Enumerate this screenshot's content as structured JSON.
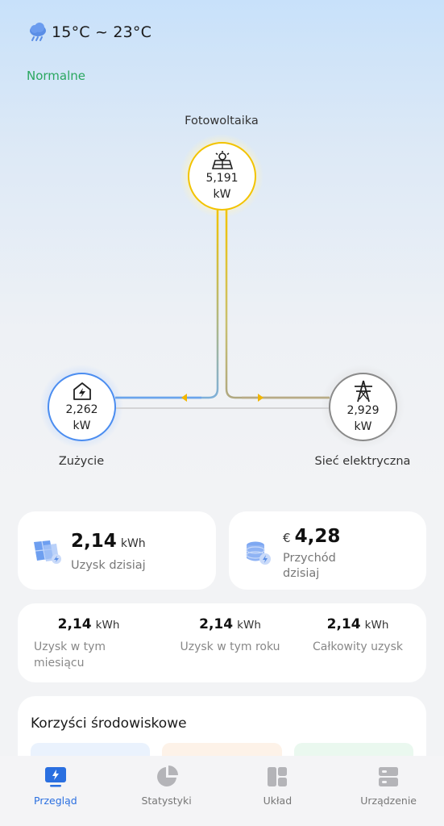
{
  "header": {
    "weather_icon": "cloud-rain-icon",
    "temperature": "15°C ~ 23°C",
    "status": "Normalne"
  },
  "flow": {
    "pv": {
      "label": "Fotowoltaika",
      "value": "5,191",
      "unit": "kW",
      "icon": "solar-panel-icon",
      "color": "#f2c300"
    },
    "consumption": {
      "label": "Zużycie",
      "value": "2,262",
      "unit": "kW",
      "icon": "home-bolt-icon",
      "color": "#4b8df0"
    },
    "grid": {
      "label": "Sieć elektryczna",
      "value": "2,929",
      "unit": "kW",
      "icon": "power-tower-icon",
      "color": "#8a8a8a"
    }
  },
  "cards": {
    "yield_today": {
      "value": "2,14",
      "unit": "kWh",
      "label": "Uzysk dzisiaj",
      "icon": "solar-panels-icon"
    },
    "income_today": {
      "currency": "€",
      "value": "4,28",
      "label_line1": "Przychód",
      "label_line2": "dzisiaj",
      "icon": "coins-icon"
    }
  },
  "stats": [
    {
      "value": "2,14",
      "unit": "kWh",
      "label_line1": "Uzysk w tym",
      "label_line2": "miesiącu"
    },
    {
      "value": "2,14",
      "unit": "kWh",
      "label_line1": "Uzysk w tym roku",
      "label_line2": ""
    },
    {
      "value": "2,14",
      "unit": "kWh",
      "label_line1": "Całkowity uzysk",
      "label_line2": ""
    }
  ],
  "env": {
    "title": "Korzyści środowiskowe"
  },
  "nav": [
    {
      "label": "Przegląd",
      "icon": "monitor-bolt-icon",
      "active": true
    },
    {
      "label": "Statystyki",
      "icon": "pie-chart-icon",
      "active": false
    },
    {
      "label": "Układ",
      "icon": "layout-icon",
      "active": false
    },
    {
      "label": "Urządzenie",
      "icon": "device-icon",
      "active": false
    }
  ],
  "colors": {
    "accent": "#2a6fe0",
    "status_green": "#2aa760",
    "pv": "#f2c300",
    "load": "#4b8df0",
    "grid": "#8a8a8a"
  }
}
